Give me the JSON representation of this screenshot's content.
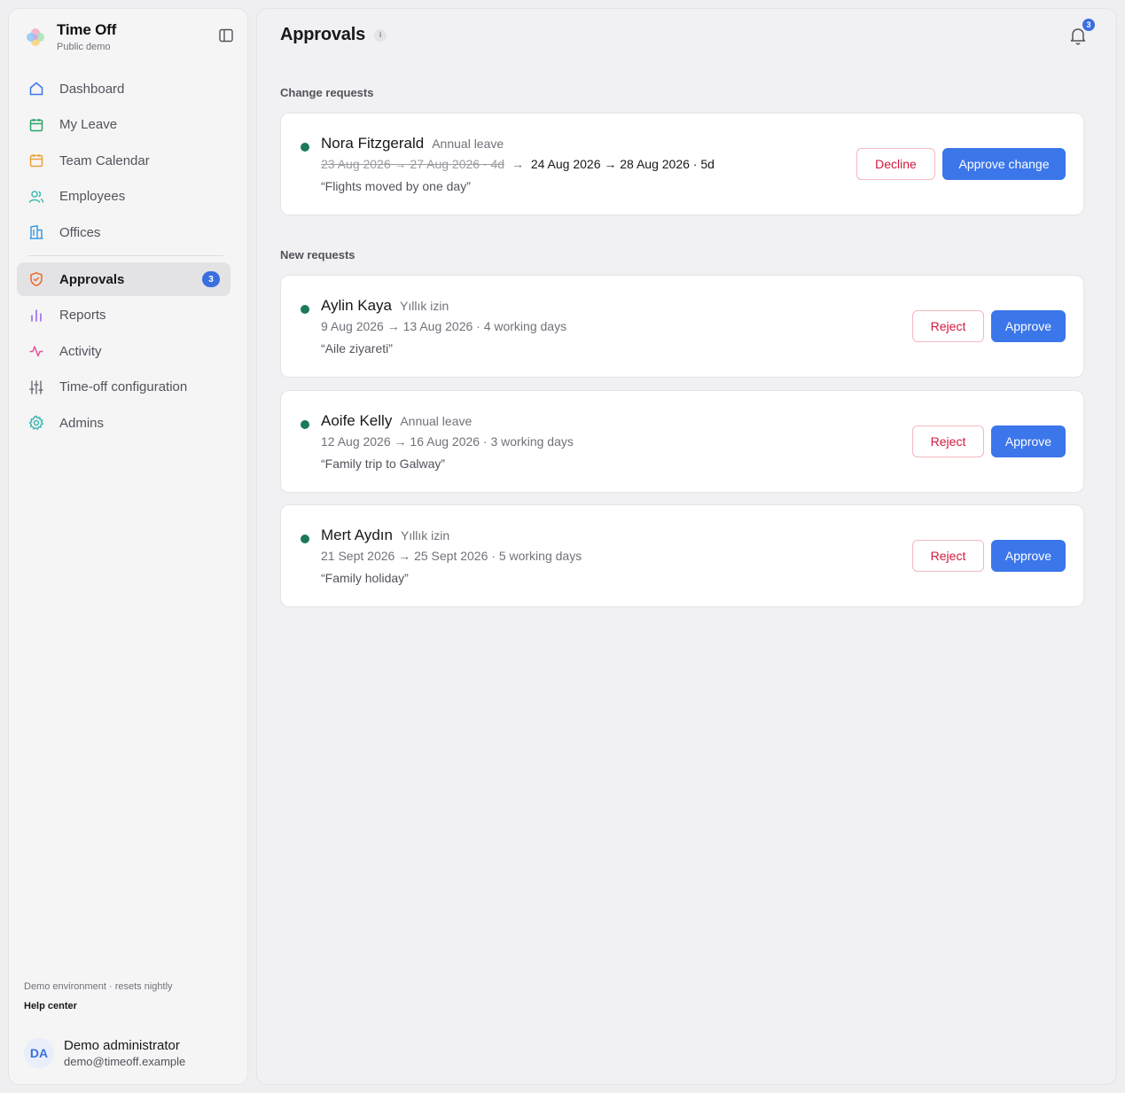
{
  "app": {
    "title": "Time Off",
    "subtitle": "Public demo"
  },
  "sidebar": {
    "items": [
      {
        "label": "Dashboard",
        "icon": "home-icon"
      },
      {
        "label": "My Leave",
        "icon": "calendar-icon"
      },
      {
        "label": "Team Calendar",
        "icon": "calendar-icon"
      },
      {
        "label": "Employees",
        "icon": "users-icon"
      },
      {
        "label": "Offices",
        "icon": "building-icon"
      }
    ],
    "items2": [
      {
        "label": "Approvals",
        "icon": "shield-check-icon",
        "badge": "3",
        "active": true
      },
      {
        "label": "Reports",
        "icon": "bar-chart-icon"
      },
      {
        "label": "Activity",
        "icon": "activity-icon"
      },
      {
        "label": "Time-off configuration",
        "icon": "sliders-icon"
      },
      {
        "label": "Admins",
        "icon": "gear-icon"
      }
    ],
    "footer_note": "Demo environment · resets nightly",
    "help_link": "Help center",
    "user": {
      "initials": "DA",
      "name": "Demo administrator",
      "email": "demo@timeoff.example"
    }
  },
  "header": {
    "title": "Approvals",
    "info": "i",
    "notification_count": "3"
  },
  "sections": {
    "change": "Change requests",
    "new": "New requests"
  },
  "change_request": {
    "name": "Nora Fitzgerald",
    "type": "Annual leave",
    "old_dates": "23 Aug 2026 → 27 Aug 2026 · 4d",
    "arrow": "→",
    "new_dates": "24 Aug 2026 → 28 Aug 2026 · 5d",
    "note": "“Flights moved by one day”",
    "decline_label": "Decline",
    "approve_label": "Approve change"
  },
  "requests": [
    {
      "name": "Aylin Kaya",
      "type": "Yıllık izin",
      "dates": "9 Aug 2026 → 13 Aug 2026 · 4 working days",
      "note": "“Aile ziyareti”",
      "reject_label": "Reject",
      "approve_label": "Approve"
    },
    {
      "name": "Aoife Kelly",
      "type": "Annual leave",
      "dates": "12 Aug 2026 → 16 Aug 2026 · 3 working days",
      "note": "“Family trip to Galway”",
      "reject_label": "Reject",
      "approve_label": "Approve"
    },
    {
      "name": "Mert Aydın",
      "type": "Yıllık izin",
      "dates": "21 Sept 2026 → 25 Sept 2026 · 5 working days",
      "note": "“Family holiday”",
      "reject_label": "Reject",
      "approve_label": "Approve"
    }
  ],
  "colors": {
    "accent": "#3b76ea",
    "danger": "#d4183d",
    "status_dot": "#1a7a5a"
  }
}
